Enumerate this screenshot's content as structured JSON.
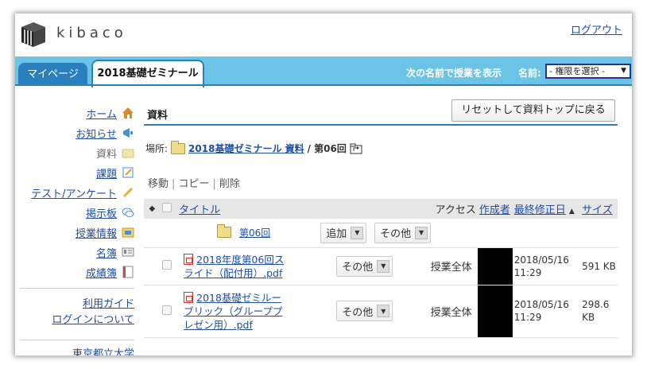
{
  "app": {
    "logo_text": "kibaco",
    "logout_label": "ログアウト"
  },
  "tabs": {
    "mypage": "マイページ",
    "active": "2018基礎ゼミナール"
  },
  "name_display": {
    "label": "次の名前で授業を表示",
    "name_label": "名前:",
    "role_value": "- 権限を選択 -"
  },
  "sidebar": {
    "items": [
      {
        "label": "ホーム",
        "icon": "home-icon"
      },
      {
        "label": "お知らせ",
        "icon": "announcement-icon"
      },
      {
        "label": "資料",
        "icon": "folder-icon"
      },
      {
        "label": "課題",
        "icon": "assignment-icon"
      },
      {
        "label": "テスト/アンケート",
        "icon": "pencil-icon"
      },
      {
        "label": "掲示板",
        "icon": "chat-icon"
      },
      {
        "label": "授業情報",
        "icon": "syllabus-icon"
      },
      {
        "label": "名簿",
        "icon": "roster-icon"
      },
      {
        "label": "成績簿",
        "icon": "gradebook-icon"
      }
    ],
    "guide_label": "利用ガイド",
    "login_label": "ログインについて",
    "university_label": "東京都立大学"
  },
  "main": {
    "title": "資料",
    "reset_button": "リセットして資料トップに戻る",
    "location_label": "場所:",
    "location_link": "2018基礎ゼミナール 資料",
    "location_current": "/ 第06回",
    "actions": {
      "move": "移動",
      "copy": "コピー",
      "delete": "削除"
    },
    "table": {
      "headers": {
        "title": "タイトル",
        "access": "アクセス",
        "author": "作成者",
        "modified": "最終修正日",
        "size": "サイズ"
      },
      "folder": {
        "name": "第06回",
        "add_label": "追加",
        "other_label": "その他"
      },
      "rows": [
        {
          "title_line1": "2018年度第06回ス",
          "title_line2": "ライド（配付用）.pdf",
          "other_label": "その他",
          "access": "授業全体",
          "date": "2018/05/16",
          "time": "11:29",
          "size": "591 KB"
        },
        {
          "title_line1": "2018基礎ゼミルー",
          "title_line2": "ブリック（グループプ",
          "title_line3": "レゼン用）.pdf",
          "other_label": "その他",
          "access": "授業全体",
          "date": "2018/05/16",
          "time": "11:29",
          "size_line1": "298.6",
          "size_line2": "KB"
        }
      ]
    }
  },
  "colors": {
    "tabbar": "#6bc3e6",
    "accent": "#2a7fbf",
    "link": "#1f4ea8"
  }
}
